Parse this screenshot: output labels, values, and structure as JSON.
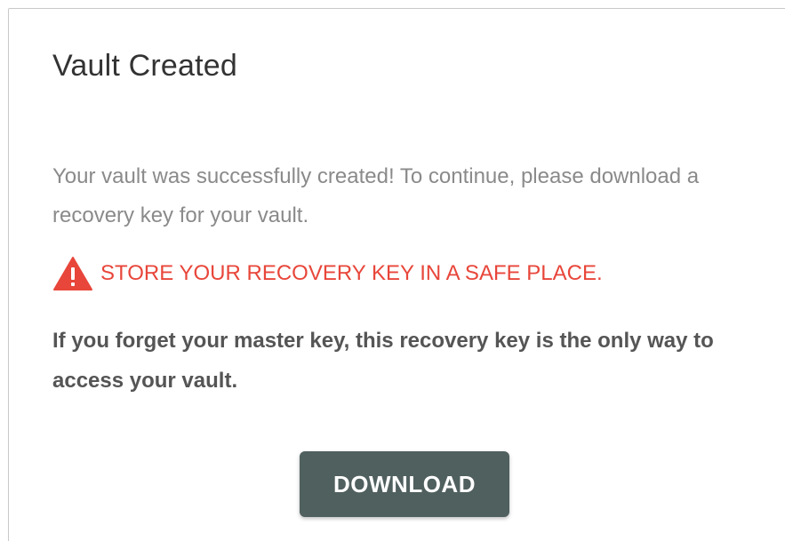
{
  "dialog": {
    "title": "Vault Created",
    "description": "Your vault was successfully created! To continue, please download a recovery key for your vault.",
    "warning": {
      "icon": "warning-triangle-icon",
      "text": "STORE YOUR RECOVERY KEY IN A SAFE PLACE.",
      "color": "#e8463a"
    },
    "info": "If you forget your master key, this recovery key is the only way to access your vault.",
    "download_label": "DOWNLOAD",
    "button_color": "#50605f"
  }
}
